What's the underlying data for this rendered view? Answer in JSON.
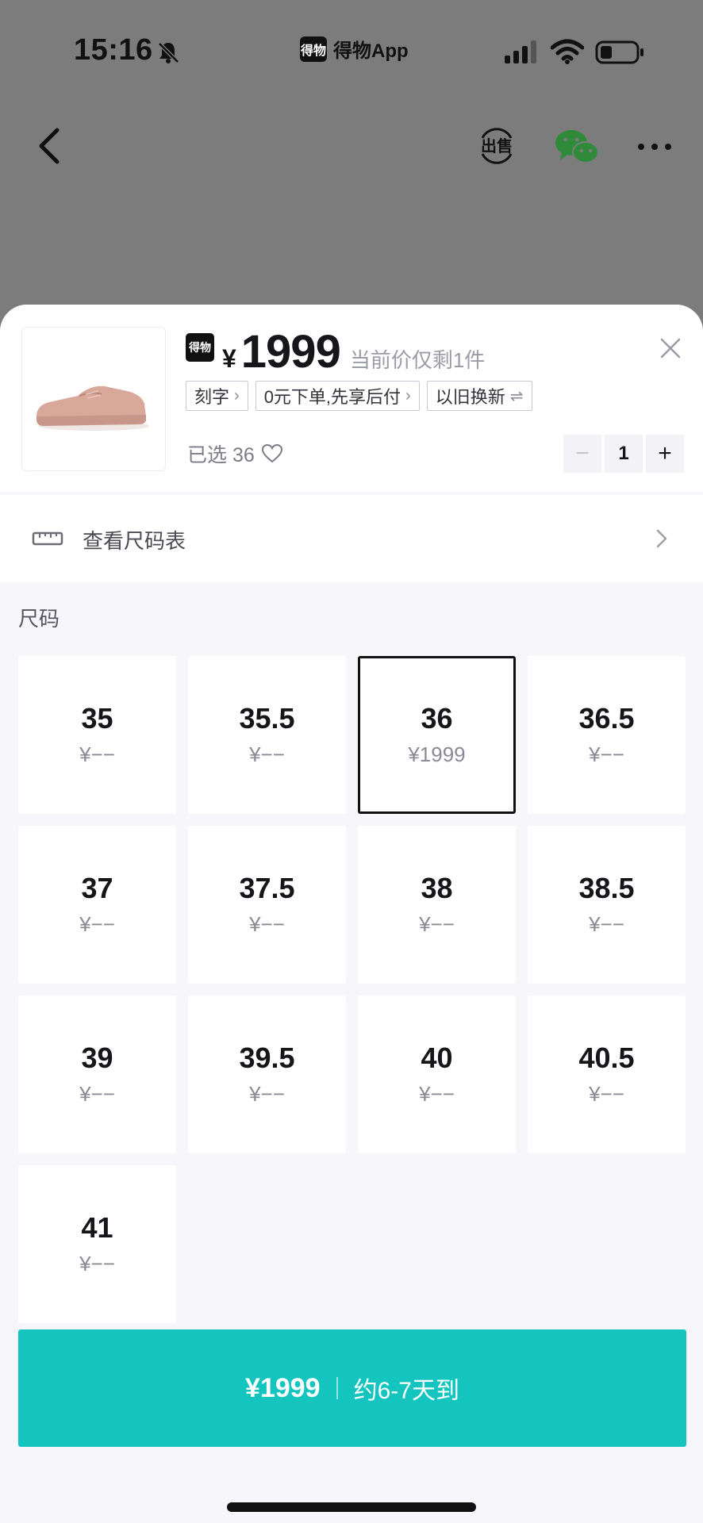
{
  "status_bar": {
    "time": "15:16",
    "app_logo": "得物",
    "app_name": "得物App",
    "icons": [
      "bell-muted-icon",
      "cellular-signal-icon",
      "wifi-icon",
      "battery-icon"
    ]
  },
  "nav": {
    "icons": [
      "back-chevron-icon",
      "sell-icon",
      "wechat-icon",
      "more-dots-icon"
    ]
  },
  "product": {
    "brand_badge": "得物",
    "currency": "¥",
    "price": "1999",
    "stock_note": "当前价仅剩1件",
    "tags": [
      {
        "label": "刻字",
        "icon": "›"
      },
      {
        "label": "0元下单,先享后付",
        "icon": "›"
      },
      {
        "label": "以旧换新",
        "icon": "⇌"
      }
    ],
    "selected_label": "已选 36",
    "quantity": "1"
  },
  "size_chart": {
    "label": "查看尺码表"
  },
  "sizes": {
    "section_title": "尺码",
    "items": [
      {
        "size": "35",
        "price": "¥−−",
        "selected": false
      },
      {
        "size": "35.5",
        "price": "¥−−",
        "selected": false
      },
      {
        "size": "36",
        "price": "¥1999",
        "selected": true
      },
      {
        "size": "36.5",
        "price": "¥−−",
        "selected": false
      },
      {
        "size": "37",
        "price": "¥−−",
        "selected": false
      },
      {
        "size": "37.5",
        "price": "¥−−",
        "selected": false
      },
      {
        "size": "38",
        "price": "¥−−",
        "selected": false
      },
      {
        "size": "38.5",
        "price": "¥−−",
        "selected": false
      },
      {
        "size": "39",
        "price": "¥−−",
        "selected": false
      },
      {
        "size": "39.5",
        "price": "¥−−",
        "selected": false
      },
      {
        "size": "40",
        "price": "¥−−",
        "selected": false
      },
      {
        "size": "40.5",
        "price": "¥−−",
        "selected": false
      },
      {
        "size": "41",
        "price": "¥−−",
        "selected": false
      }
    ]
  },
  "buy_bar": {
    "price": "¥1999",
    "eta": "约6-7天到"
  },
  "colors": {
    "accent": "#13c4bf",
    "overlay": "#7c7c7c",
    "sheet_bg": "#f7f7fb",
    "selected_border": "#111111",
    "wechat_green": "#2f8a3a"
  }
}
